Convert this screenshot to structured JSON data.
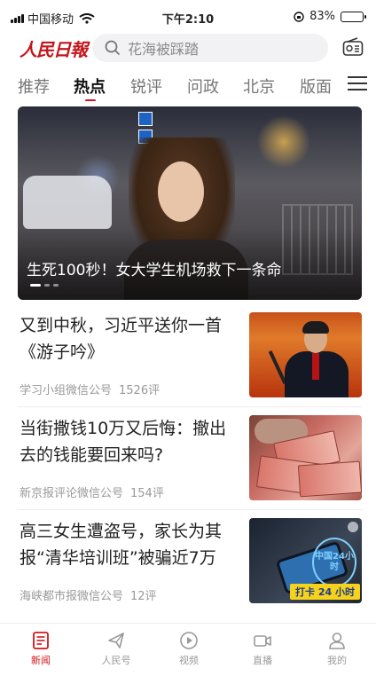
{
  "status_bar": {
    "carrier": "中国移动",
    "time": "下午2:10",
    "battery": "83%",
    "battery_level": 0.83
  },
  "header": {
    "logo": "人民日報",
    "search_placeholder": "花海被踩踏",
    "icons": {
      "search": "search-icon",
      "radio": "radio-icon"
    }
  },
  "tabs": [
    {
      "label": "推荐"
    },
    {
      "label": "热点"
    },
    {
      "label": "锐评"
    },
    {
      "label": "问政"
    },
    {
      "label": "北京"
    },
    {
      "label": "版面"
    }
  ],
  "active_tab": "热点",
  "colors": {
    "accent": "#d0161c",
    "logo": "#c4161c",
    "meta": "#999999"
  },
  "hero": {
    "title": "生死100秒！女大学生机场救下一条命",
    "slide_count": 3,
    "active_slide": 1
  },
  "news": [
    {
      "title": "又到中秋，习近平送你一首《游子吟》",
      "source": "学习小组微信公号",
      "comments": "1526评"
    },
    {
      "title": "当街撒钱10万又后悔：撤出去的钱能要回来吗?",
      "source": "新京报评论微信公号",
      "comments": "154评"
    },
    {
      "title": "高三女生遭盗号，家长为其报“清华培训班”被骗近7万",
      "source": "海峡都市报微信公号",
      "comments": "12评",
      "thumb_badge": "中国24小时",
      "thumb_tag": "打卡 24 小时"
    }
  ],
  "bottom_nav": [
    {
      "label": "新闻",
      "icon": "news-icon",
      "active": true
    },
    {
      "label": "人民号",
      "icon": "paper-plane-icon",
      "active": false
    },
    {
      "label": "视频",
      "icon": "play-icon",
      "active": false
    },
    {
      "label": "直播",
      "icon": "video-camera-icon",
      "active": false
    },
    {
      "label": "我的",
      "icon": "user-icon",
      "active": false
    }
  ]
}
